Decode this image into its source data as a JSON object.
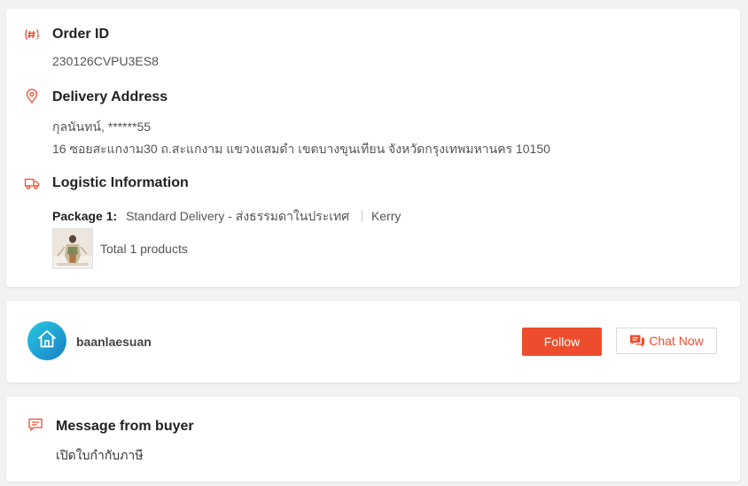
{
  "order": {
    "order_id_title": "Order ID",
    "order_id_value": "230126CVPU3ES8"
  },
  "delivery": {
    "title": "Delivery Address",
    "recipient": "กุลนันทน์, ******55",
    "address": "16 ซอยสะแกงาม30 ถ.สะแกงาม แขวงแสมดำ เขตบางขุนเทียน จังหวัดกรุงเทพมหานคร 10150"
  },
  "logistic": {
    "title": "Logistic Information",
    "package_label": "Package 1:",
    "service": "Standard Delivery - ส่งธรรมดาในประเทศ",
    "carrier": "Kerry",
    "total_products": "Total 1 products"
  },
  "shop": {
    "name": "baanlaesuan",
    "follow_label": "Follow",
    "chat_label": "Chat Now"
  },
  "message": {
    "title": "Message from buyer",
    "text": "เปิดใบกำกับภาษี"
  },
  "icons": {
    "order_id": "hash-icon",
    "delivery": "location-pin-icon",
    "logistic": "truck-icon",
    "chat": "chat-bubble-icon",
    "message": "message-icon",
    "avatar": "house-icon"
  },
  "colors": {
    "accent": "#ee4d2d",
    "background": "#f2f2f2",
    "card": "#ffffff"
  }
}
